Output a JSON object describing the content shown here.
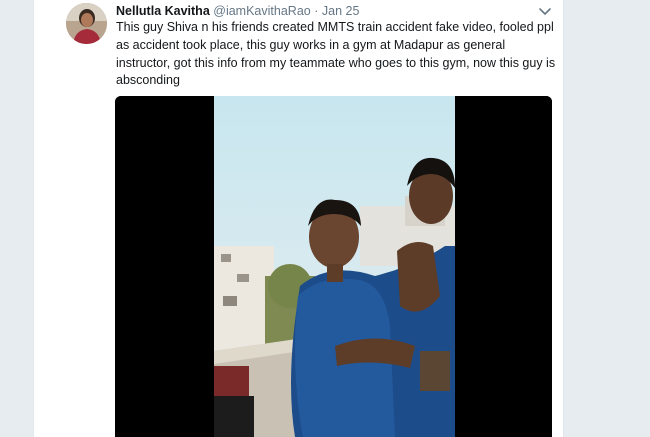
{
  "tweet": {
    "display_name": "Nellutla Kavitha",
    "handle": "@iamKavithaRao",
    "separator": "·",
    "date": "Jan 25",
    "text": "This guy Shiva n his friends created MMTS train accident fake video,  fooled ppl as accident took place, this guy works in a gym at Madapur as general instructor, got this info from my teammate who goes to this gym, now this guy is absconding"
  },
  "icons": {
    "more": "chevron-down-icon",
    "avatar": "avatar"
  },
  "colors": {
    "name": "#14171a",
    "meta": "#657786",
    "background": "#e6ecf0",
    "card": "#ffffff"
  }
}
